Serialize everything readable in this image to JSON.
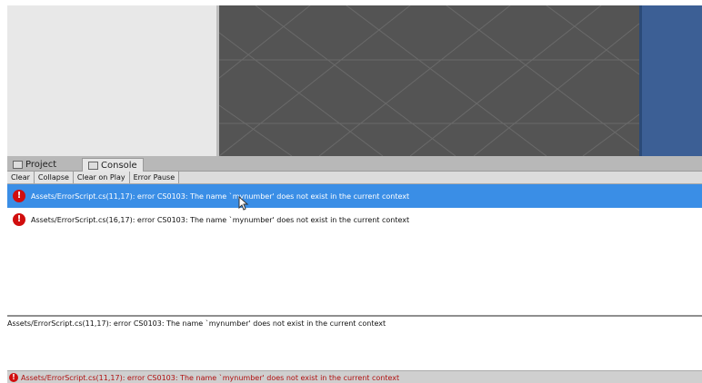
{
  "tabs": {
    "project_label": "Project",
    "console_label": "Console"
  },
  "toolbar": {
    "clear_label": "Clear",
    "collapse_label": "Collapse",
    "clear_on_play_label": "Clear on Play",
    "error_pause_label": "Error Pause"
  },
  "log": {
    "entries": [
      {
        "text": "Assets/ErrorScript.cs(11,17): error CS0103: The name `mynumber' does not exist in the current context",
        "selected": true,
        "icon": "error-icon"
      },
      {
        "text": "Assets/ErrorScript.cs(16,17): error CS0103: The name `mynumber' does not exist in the current context",
        "selected": false,
        "icon": "error-icon"
      }
    ]
  },
  "detail": {
    "text": "Assets/ErrorScript.cs(11,17): error CS0103: The name `mynumber' does not exist in the current context"
  },
  "status": {
    "text": "Assets/ErrorScript.cs(11,17): error CS0103: The name `mynumber' does not exist in the current context",
    "icon": "error-icon"
  },
  "colors": {
    "selected_row": "#3a8ee6",
    "error_red": "#d10e0e",
    "scene_bg": "#545454",
    "inspector_blue": "#3c5f95"
  }
}
